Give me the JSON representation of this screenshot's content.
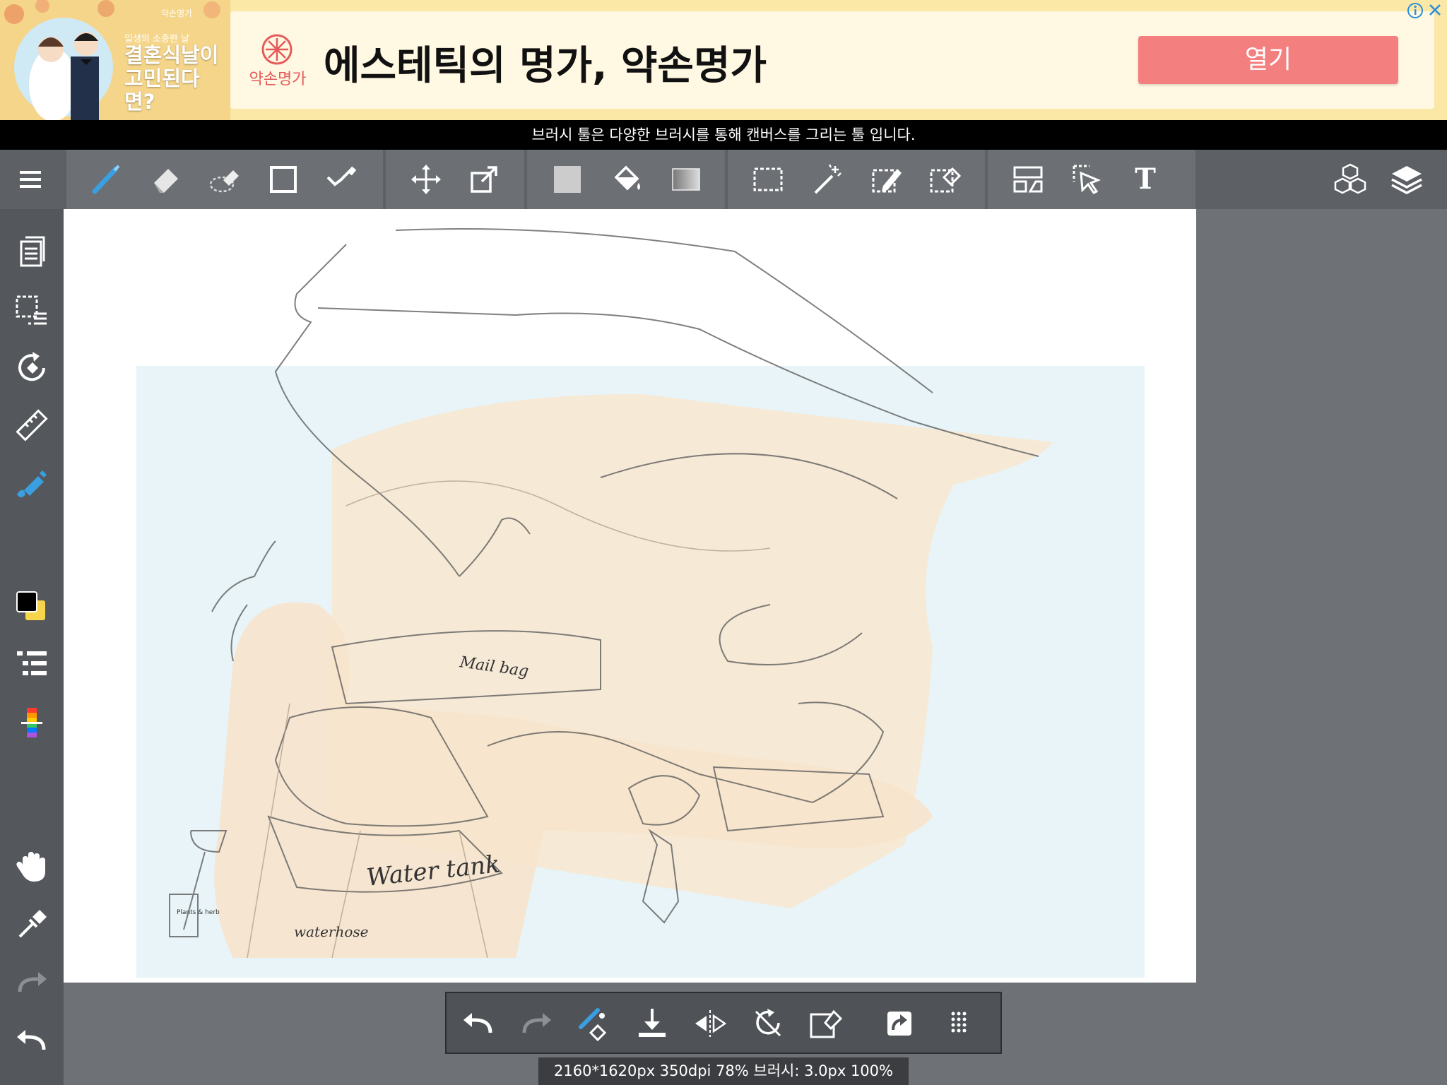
{
  "ad": {
    "banner_tag": "약손명가",
    "banner_small": "일생의 소중한 날",
    "banner_title": "결혼식날이 고민된다면?",
    "brand_name": "약손명가",
    "headline": "에스테틱의 명가, 약손명가",
    "cta_label": "열기",
    "adchoices_icon": "info-icon",
    "close_icon": "close-icon"
  },
  "tooltip": {
    "text": "브러시 툴은 다양한 브러시를 통해 캔버스를 그리는 툴 입니다."
  },
  "toolbar": {
    "menu_icon": "hamburger-menu-icon",
    "tools": [
      "brush",
      "eraser",
      "blur",
      "shape",
      "dot",
      "move",
      "transform",
      "fill-rect",
      "bucket",
      "gradient",
      "select",
      "magic-wand",
      "select-pen",
      "select-eraser",
      "frame-divider",
      "operation",
      "text"
    ],
    "right_icons": [
      "material-icon",
      "layers-icon"
    ],
    "active_tool": "brush",
    "text_tool_glyph": "T"
  },
  "sidebar": {
    "items": [
      "page-manager",
      "selection-layer",
      "snap",
      "ruler",
      "edit",
      "color-swatch",
      "brush-list",
      "color-palette",
      "hand",
      "eyedropper",
      "redo",
      "undo"
    ],
    "primary_color": "#000000",
    "secondary_color": "#f7d54a"
  },
  "canvas": {
    "sketch_labels": {
      "mail_bag": "Mail bag",
      "water_tank": "Water tank",
      "water_hose": "waterhose",
      "book": "Plants & herb"
    }
  },
  "bottom_bar": {
    "actions": [
      "undo",
      "redo",
      "brush-settings",
      "save",
      "flip",
      "rotate-reset",
      "clear",
      "share",
      "grid"
    ]
  },
  "status": {
    "text": "2160*1620px 350dpi 78% 브러시: 3.0px 100%"
  },
  "colors": {
    "accent_blue": "#3a9fe0",
    "ad_button": "#f47f7f",
    "sky": "#e8f4f7",
    "dragon_fill": "#f8e6d0"
  }
}
